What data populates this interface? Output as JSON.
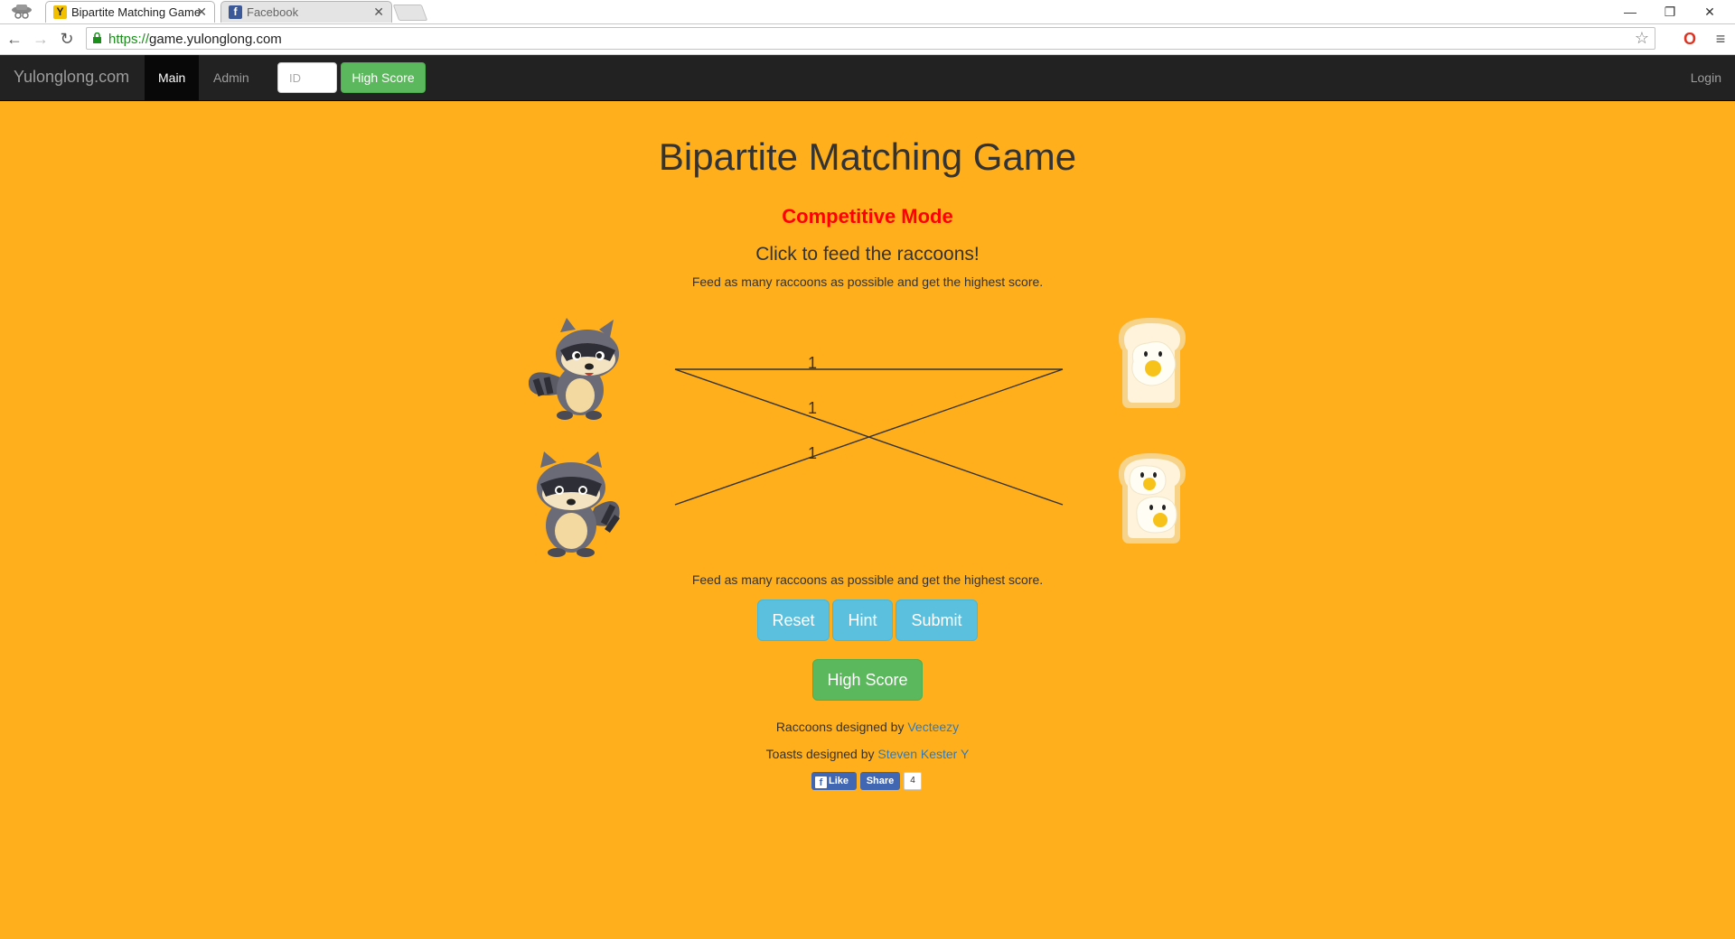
{
  "browser": {
    "tabs": [
      {
        "title": "Bipartite Matching Game",
        "favicon": "Y",
        "active": true
      },
      {
        "title": "Facebook",
        "favicon": "f",
        "active": false
      }
    ],
    "url_scheme": "https://",
    "url_host": "game.yulonglong.com"
  },
  "navbar": {
    "brand": "Yulonglong.com",
    "links": [
      {
        "label": "Main",
        "active": true
      },
      {
        "label": "Admin",
        "active": false
      }
    ],
    "id_placeholder": "ID",
    "highscore_label": "High Score",
    "login_label": "Login"
  },
  "main": {
    "title": "Bipartite Matching Game",
    "mode": "Competitive Mode",
    "instruction": "Click to feed the raccoons!",
    "subtitle_top": "Feed as many raccoons as possible and get the highest score.",
    "subtitle_bottom": "Feed as many raccoons as possible and get the highest score.",
    "edge_weights": [
      "1",
      "1",
      "1"
    ],
    "buttons": {
      "reset": "Reset",
      "hint": "Hint",
      "submit": "Submit",
      "highscore": "High Score"
    }
  },
  "credits": {
    "raccoons_text": "Raccoons designed by ",
    "raccoons_link": "Vecteezy",
    "toasts_text": "Toasts designed by ",
    "toasts_link": "Steven Kester Y"
  },
  "social": {
    "like": "Like",
    "share": "Share",
    "count": "4"
  },
  "colors": {
    "page_bg": "#ffaf1c",
    "mode_red": "#ff0000",
    "info_blue": "#5bc0de",
    "success_green": "#5cb85c",
    "navbar": "#222222"
  }
}
